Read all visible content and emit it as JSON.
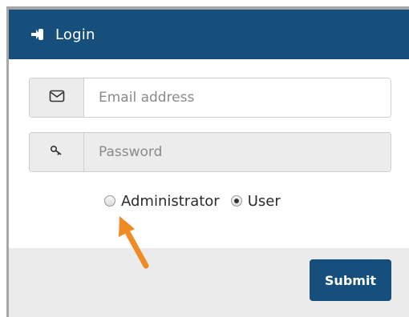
{
  "header": {
    "title": "Login",
    "icon": "login-icon",
    "background": "#164f7c"
  },
  "form": {
    "email": {
      "placeholder": "Email address",
      "icon": "envelope-icon"
    },
    "password": {
      "placeholder": "Password",
      "icon": "key-icon"
    },
    "role": {
      "options": [
        "Administrator",
        "User"
      ],
      "selected": "User"
    }
  },
  "footer": {
    "submit_label": "Submit",
    "button_color": "#164f7c"
  },
  "annotation": {
    "arrow_color": "#f08a25"
  }
}
